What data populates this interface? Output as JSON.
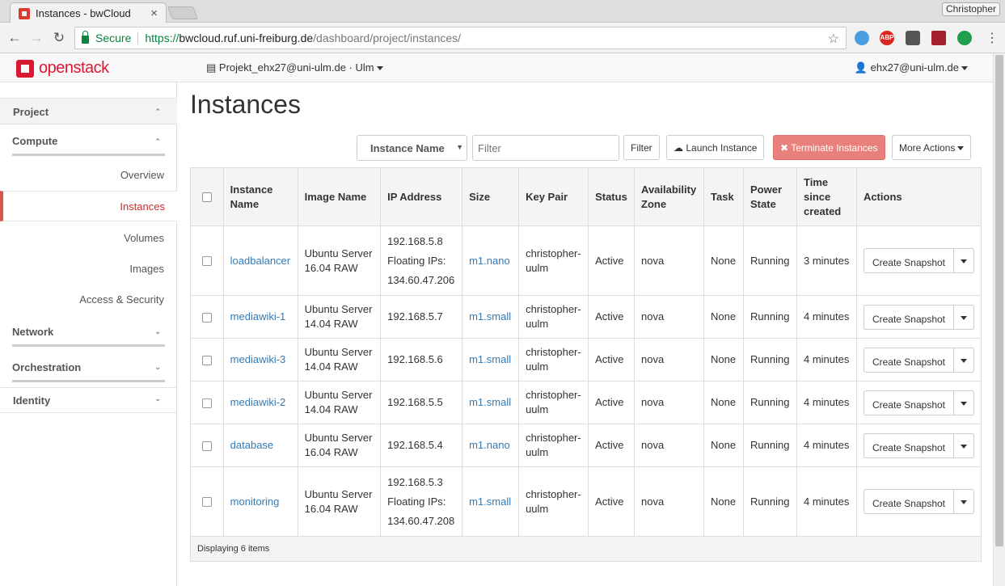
{
  "browser": {
    "tab_title": "Instances - bwCloud",
    "tab_close": "×",
    "profile_name": "Christopher",
    "secure_label": "Secure",
    "url_scheme": "https://",
    "url_host": "bwcloud.ruf.uni-freiburg.de",
    "url_path": "/dashboard/project/instances/",
    "back": "←",
    "forward": "→",
    "reload": "↻",
    "star": "☆",
    "menu": "⋮",
    "ext_abp": "ABP"
  },
  "header": {
    "logo_left": "open",
    "logo_right": "stack",
    "project": "Projekt_ehx27@uni-ulm.de · Ulm",
    "user": "ehx27@uni-ulm.de"
  },
  "sidebar": {
    "project": "Project",
    "compute": "Compute",
    "items": [
      "Overview",
      "Instances",
      "Volumes",
      "Images",
      "Access & Security"
    ],
    "network": "Network",
    "orchestration": "Orchestration",
    "identity": "Identity"
  },
  "main": {
    "title": "Instances",
    "filter_select": "Instance Name",
    "filter_placeholder": "Filter",
    "filter_button": "Filter",
    "launch_button": "Launch Instance",
    "terminate_button": "Terminate Instances",
    "more_actions": "More Actions",
    "columns": [
      "Instance Name",
      "Image Name",
      "IP Address",
      "Size",
      "Key Pair",
      "Status",
      "Availability Zone",
      "Task",
      "Power State",
      "Time since created",
      "Actions"
    ],
    "rows": [
      {
        "name": "loadbalancer",
        "image": "Ubuntu Server 16.04 RAW",
        "ip": "192.168.5.8",
        "floating_label": "Floating IPs:",
        "floating_ip": "134.60.47.206",
        "size": "m1.nano",
        "keypair": "christopher-uulm",
        "status": "Active",
        "zone": "nova",
        "task": "None",
        "power": "Running",
        "age": "3 minutes",
        "action": "Create Snapshot"
      },
      {
        "name": "mediawiki-1",
        "image": "Ubuntu Server 14.04 RAW",
        "ip": "192.168.5.7",
        "size": "m1.small",
        "keypair": "christopher-uulm",
        "status": "Active",
        "zone": "nova",
        "task": "None",
        "power": "Running",
        "age": "4 minutes",
        "action": "Create Snapshot"
      },
      {
        "name": "mediawiki-3",
        "image": "Ubuntu Server 14.04 RAW",
        "ip": "192.168.5.6",
        "size": "m1.small",
        "keypair": "christopher-uulm",
        "status": "Active",
        "zone": "nova",
        "task": "None",
        "power": "Running",
        "age": "4 minutes",
        "action": "Create Snapshot"
      },
      {
        "name": "mediawiki-2",
        "image": "Ubuntu Server 14.04 RAW",
        "ip": "192.168.5.5",
        "size": "m1.small",
        "keypair": "christopher-uulm",
        "status": "Active",
        "zone": "nova",
        "task": "None",
        "power": "Running",
        "age": "4 minutes",
        "action": "Create Snapshot"
      },
      {
        "name": "database",
        "image": "Ubuntu Server 16.04 RAW",
        "ip": "192.168.5.4",
        "size": "m1.nano",
        "keypair": "christopher-uulm",
        "status": "Active",
        "zone": "nova",
        "task": "None",
        "power": "Running",
        "age": "4 minutes",
        "action": "Create Snapshot"
      },
      {
        "name": "monitoring",
        "image": "Ubuntu Server 16.04 RAW",
        "ip": "192.168.5.3",
        "floating_label": "Floating IPs:",
        "floating_ip": "134.60.47.208",
        "size": "m1.small",
        "keypair": "christopher-uulm",
        "status": "Active",
        "zone": "nova",
        "task": "None",
        "power": "Running",
        "age": "4 minutes",
        "action": "Create Snapshot"
      }
    ],
    "footer": "Displaying 6 items"
  },
  "colors": {
    "accent": "#da1a32",
    "link": "#337ab7",
    "danger_button": "#e8807c",
    "secure_green": "#0b8043"
  }
}
